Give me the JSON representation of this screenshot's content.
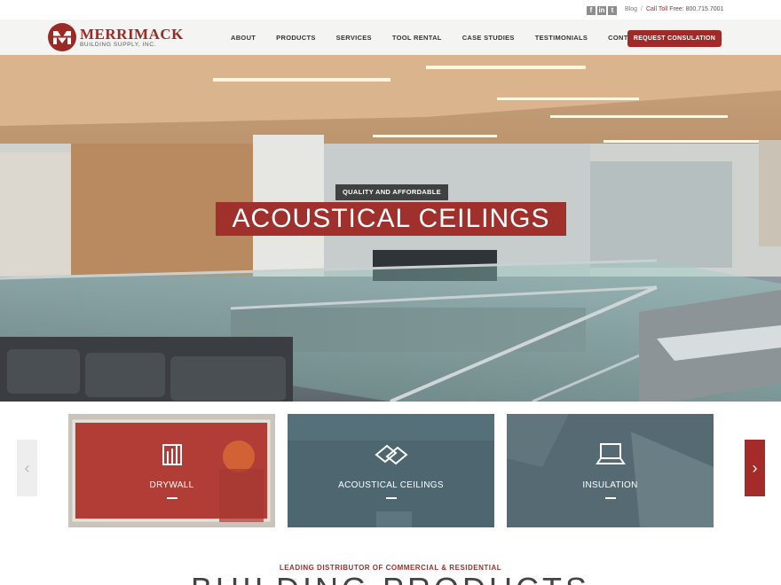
{
  "topbar": {
    "social": [
      "facebook-icon",
      "linkedin-icon",
      "twitter-icon"
    ],
    "social_glyphs": [
      "f",
      "in",
      "t"
    ],
    "blog_label": "Blog",
    "separator": "/",
    "toll_label": "Call Toll Free:",
    "phone": "800.715.7001"
  },
  "header": {
    "logo_name": "MERRIMACK",
    "logo_sub": "BUILDING SUPPLY, INC.",
    "nav": [
      "ABOUT",
      "PRODUCTS",
      "SERVICES",
      "TOOL RENTAL",
      "CASE STUDIES",
      "TESTIMONIALS",
      "CONTACT"
    ],
    "cta_label": "REQUEST CONSULATION"
  },
  "hero": {
    "eyebrow": "QUALITY AND AFFORDABLE",
    "title": "ACOUSTICAL CEILINGS"
  },
  "tiles": [
    {
      "label": "DRYWALL",
      "icon": "drywall-icon"
    },
    {
      "label": "ACOUSTICAL CEILINGS",
      "icon": "ceiling-tiles-icon"
    },
    {
      "label": "INSULATION",
      "icon": "insulation-icon"
    }
  ],
  "carousel": {
    "prev_glyph": "‹",
    "next_glyph": "›"
  },
  "section": {
    "kicker": "LEADING DISTRIBUTOR OF COMMERCIAL & RESIDENTIAL",
    "headline": "BUILDING PRODUCTS"
  },
  "colors": {
    "brand_red": "#a0302c",
    "tile_slate": "#4d6670",
    "header_bg": "#f4f4f2"
  }
}
